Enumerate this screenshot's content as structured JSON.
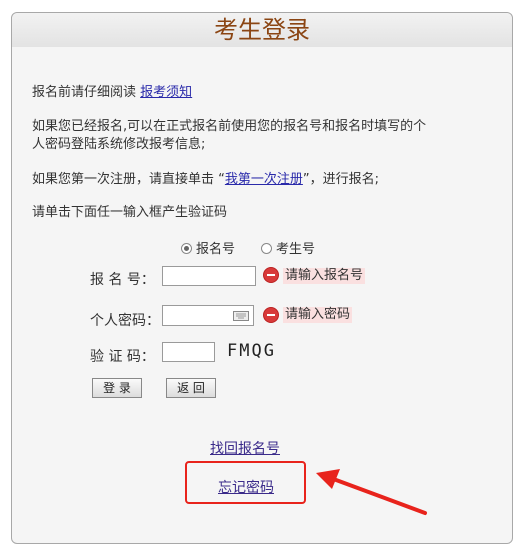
{
  "title": "考生登录",
  "intro": {
    "line1_text": "报名前请仔细阅读",
    "line1_link": "报考须知",
    "line2a": "如果您已经报名,可以在正式报名前使用您的报名号和报名时填写的个",
    "line2b": "人密码登陆系统修改报考信息;",
    "line3_prefix": "如果您第一次注册，请直接单击 “",
    "line3_link": "我第一次注册",
    "line3_suffix": "”，进行报名;",
    "line4": "请单击下面任一输入框产生验证码"
  },
  "radio": {
    "option1": "报名号",
    "option2": "考生号",
    "selected": "报名号"
  },
  "form": {
    "id_label": "报 名 号：",
    "id_error": "请输入报名号",
    "password_label": "个人密码：",
    "password_error": "请输入密码",
    "captcha_label": "验 证 码：",
    "captcha_text": "FMQG"
  },
  "buttons": {
    "login": "登 录",
    "back": "返 回"
  },
  "links": {
    "find_id": "找回报名号",
    "forgot_password": "忘记密码"
  },
  "colors": {
    "title": "#8b4513",
    "error_bg": "#fae0e0",
    "annotation": "#e8231c"
  }
}
